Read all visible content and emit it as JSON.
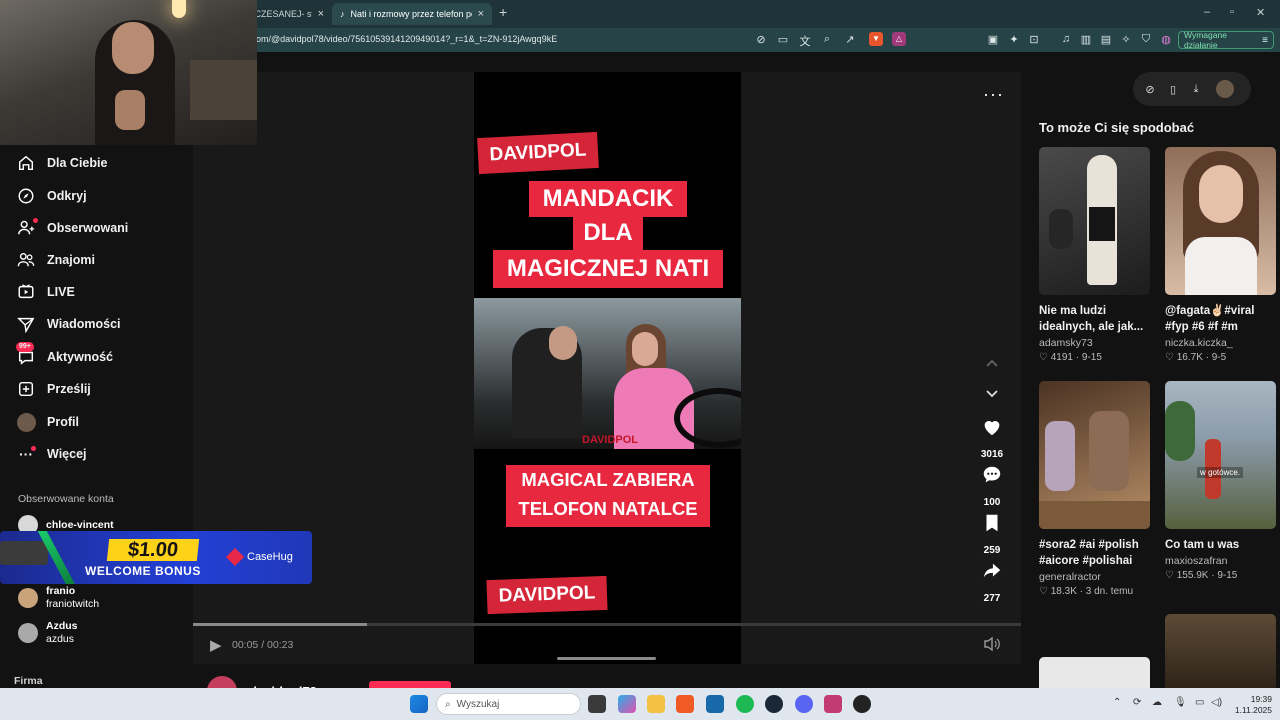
{
  "browser": {
    "tabs": [
      {
        "label": "UCZESANEJ- stro",
        "active": false
      },
      {
        "label": "Nati i rozmowy przez telefon po",
        "active": true
      }
    ],
    "url": "om/@davidpol78/video/7561053914120949014?_r=1&_t=ZN-912jAwgq9kE",
    "required_action_label": "Wymagane działanie"
  },
  "sidebar": {
    "items": [
      {
        "label": "Dla Ciebie",
        "icon": "home-icon"
      },
      {
        "label": "Odkryj",
        "icon": "compass-icon"
      },
      {
        "label": "Obserwowani",
        "icon": "following-icon"
      },
      {
        "label": "Znajomi",
        "icon": "friends-icon"
      },
      {
        "label": "LIVE",
        "icon": "live-icon"
      },
      {
        "label": "Wiadomości",
        "icon": "send-icon"
      },
      {
        "label": "Aktywność",
        "icon": "inbox-icon",
        "badge": "99+"
      },
      {
        "label": "Prześlij",
        "icon": "upload-icon"
      },
      {
        "label": "Profil",
        "icon": "avatar-icon"
      },
      {
        "label": "Więcej",
        "icon": "more-icon"
      }
    ],
    "followed_title": "Obserwowane konta",
    "followed": [
      {
        "name": "chloe-vincent",
        "handle": ""
      },
      {
        "name": "franio",
        "handle": "franiotwitch"
      },
      {
        "name": "Azdus",
        "handle": "azdus"
      }
    ],
    "footer": "Firma"
  },
  "ad": {
    "price": "$1.00",
    "text": "WELCOME BONUS",
    "brand": "CaseHug"
  },
  "video": {
    "overlay": {
      "top_tag": "DAVIDPOL",
      "headline_lines": [
        "MANDACIK",
        "DLA",
        "MAGICZNEJ NATI"
      ],
      "sub_lines": [
        "MAGICAL ZABIERA",
        "TELOFON NATALCE"
      ],
      "bottom_tag": "DAVIDPOL",
      "watermark": "DAVIDPOL"
    },
    "time": "00:05 / 00:23",
    "progress": 0.21,
    "likes": "3016",
    "comments": "100",
    "saves": "259",
    "shares": "277",
    "author": "davidpol78"
  },
  "recommended": {
    "title": "To może Ci się spodobać",
    "cards": [
      {
        "caption": "Nie ma ludzi idealnych, ale jak...",
        "author": "adamsky73",
        "likes": "4191",
        "date": "9-15",
        "colors": [
          "#3a3a3a",
          "#1c1c1c"
        ]
      },
      {
        "caption": "@fagata✌🏻#viral #fyp #6 #f #m",
        "author": "niczka.kiczka_",
        "likes": "16.7K",
        "date": "9-5",
        "colors": [
          "#a27d65",
          "#e0c2ab"
        ]
      },
      {
        "caption": "#sora2 #ai #polish #aicore #polishai",
        "author": "generalractor",
        "likes": "18.3K",
        "date": "3 dn. temu",
        "colors": [
          "#6a4a32",
          "#b58d66"
        ]
      },
      {
        "caption": "Co tam u was",
        "author": "maxioszafran",
        "likes": "155.9K",
        "date": "9-15",
        "colors": [
          "#8a9aa8",
          "#56603e"
        ],
        "overlay": "w gotówce."
      }
    ]
  },
  "taskbar": {
    "search_placeholder": "Wyszukaj",
    "time": "19:39",
    "date": "1.11.2025"
  }
}
